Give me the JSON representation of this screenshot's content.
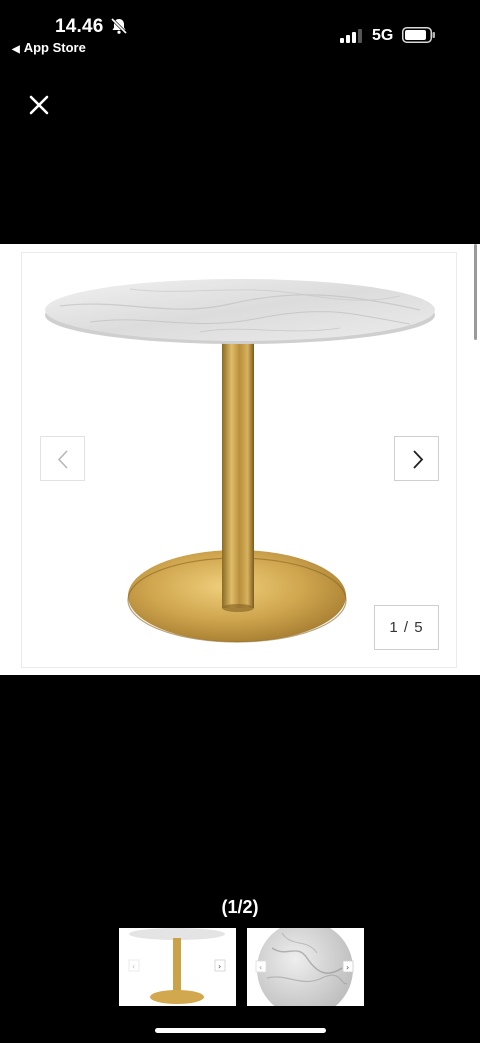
{
  "status_bar": {
    "time": "14.46",
    "back_app": "App Store",
    "network": "5G",
    "icons": [
      "bell-slash-icon",
      "signal-bars-icon",
      "battery-icon"
    ]
  },
  "viewer": {
    "close_icon": "close-icon",
    "prev_icon": "chevron-left-icon",
    "next_icon": "chevron-right-icon",
    "image_counter": "1 / 5"
  },
  "gallery": {
    "page_indicator": "(1/2)",
    "thumbnails": [
      "table-full-view",
      "marble-top-closeup"
    ]
  },
  "colors": {
    "background": "#000000",
    "viewer_background": "#ffffff",
    "brass": "#c9a24a",
    "marble": "#e6e6e6"
  }
}
